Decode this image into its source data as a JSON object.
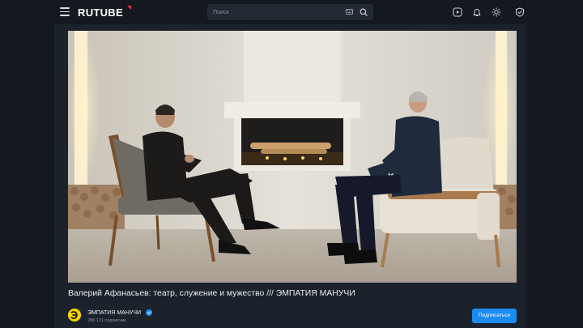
{
  "header": {
    "logo_text": "RUTUBE",
    "search": {
      "placeholder": "Поиск"
    },
    "icons": [
      "menu-icon",
      "keyboard-icon",
      "search-icon",
      "upload-video-icon",
      "bell-icon",
      "theme-sun-icon",
      "profile-shield-icon"
    ]
  },
  "video": {
    "title": "Валерий Афанасьев: театр, служение и мужество /// ЭМПАТИЯ МАНУЧИ"
  },
  "channel": {
    "name": "ЭМПАТИЯ МАНУЧИ",
    "subscribers": "288 121 подписчик",
    "subscribe_label": "Подписаться"
  },
  "colors": {
    "background": "#14191f",
    "panel": "#1b222b",
    "accent": "#1b8cf0",
    "logo_mark": "#ff2d55",
    "avatar": "#f5d400"
  }
}
